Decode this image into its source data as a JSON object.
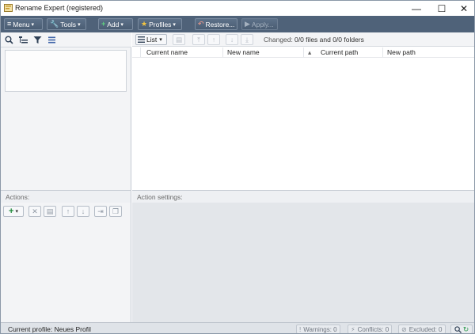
{
  "window": {
    "title": "Rename Expert (registered)",
    "minimize_glyph": "—",
    "maximize_glyph": "☐",
    "close_glyph": "✕"
  },
  "toolbar": {
    "menu_label": "Menu",
    "tools_label": "Tools",
    "add_label": "Add",
    "profiles_label": "Profiles",
    "restore_label": "Restore...",
    "apply_label": "Apply..."
  },
  "list_toolbar": {
    "view_label": "List",
    "changed_label": "Changed:",
    "changed_value": "0/0 files and 0/0 folders"
  },
  "file_list": {
    "columns": [
      "Current name",
      "New name",
      "Current path",
      "New path"
    ]
  },
  "actions": {
    "header": "Actions:"
  },
  "action_settings": {
    "header": "Action settings:"
  },
  "statusbar": {
    "profile_text": "Current profile: Neues Profil",
    "warnings": "Warnings: 0",
    "conflicts": "Conflicts: 0",
    "excluded": "Excluded: 0"
  },
  "icons": {
    "menu": "hamburger-icon",
    "tools": "wrench-icon",
    "add": "plus-icon",
    "profiles": "star-icon",
    "restore": "undo-icon",
    "apply": "play-icon"
  },
  "colors": {
    "toolbar_bg": "#4f6279",
    "settings_bg": "#e3e6ea",
    "accent_green": "#1f8a3b"
  }
}
